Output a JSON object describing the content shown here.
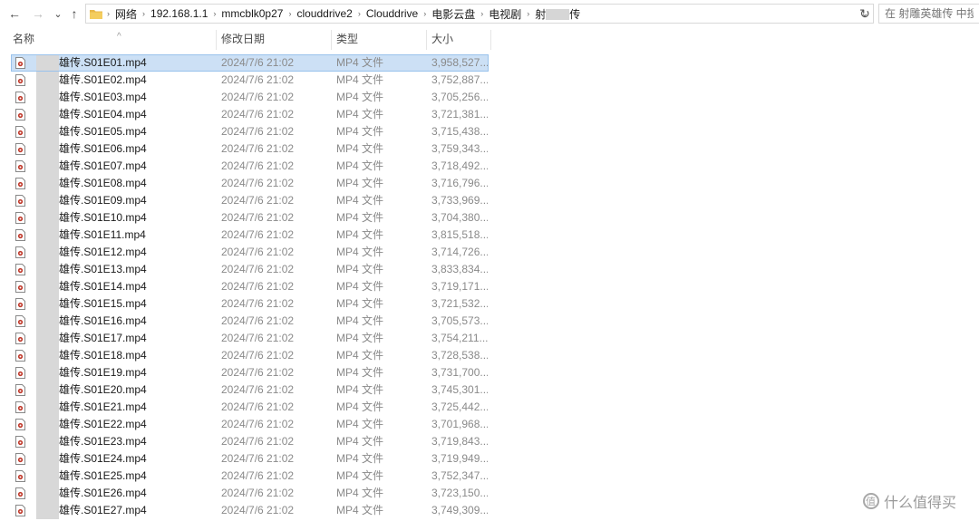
{
  "nav": {
    "back": "←",
    "forward": "→",
    "recent": "⌄",
    "up": "↑"
  },
  "address": {
    "crumbs": [
      "网络",
      "192.168.1.1",
      "mmcblk0p27",
      "clouddrive2",
      "Clouddrive",
      "电影云盘",
      "电视剧"
    ],
    "last_crumb_prefix": "射",
    "last_crumb_suffix": "传"
  },
  "search": {
    "placeholder": "在 射雕英雄传 中搜索"
  },
  "columns": {
    "name": "名称",
    "date": "修改日期",
    "type": "类型",
    "size": "大小"
  },
  "files": [
    {
      "name": "雄传.S01E01.mp4",
      "date": "2024/7/6 21:02",
      "type": "MP4 文件",
      "size": "3,958,527..."
    },
    {
      "name": "雄传.S01E02.mp4",
      "date": "2024/7/6 21:02",
      "type": "MP4 文件",
      "size": "3,752,887..."
    },
    {
      "name": "雄传.S01E03.mp4",
      "date": "2024/7/6 21:02",
      "type": "MP4 文件",
      "size": "3,705,256..."
    },
    {
      "name": "雄传.S01E04.mp4",
      "date": "2024/7/6 21:02",
      "type": "MP4 文件",
      "size": "3,721,381..."
    },
    {
      "name": "雄传.S01E05.mp4",
      "date": "2024/7/6 21:02",
      "type": "MP4 文件",
      "size": "3,715,438..."
    },
    {
      "name": "雄传.S01E06.mp4",
      "date": "2024/7/6 21:02",
      "type": "MP4 文件",
      "size": "3,759,343..."
    },
    {
      "name": "雄传.S01E07.mp4",
      "date": "2024/7/6 21:02",
      "type": "MP4 文件",
      "size": "3,718,492..."
    },
    {
      "name": "雄传.S01E08.mp4",
      "date": "2024/7/6 21:02",
      "type": "MP4 文件",
      "size": "3,716,796..."
    },
    {
      "name": "雄传.S01E09.mp4",
      "date": "2024/7/6 21:02",
      "type": "MP4 文件",
      "size": "3,733,969..."
    },
    {
      "name": "雄传.S01E10.mp4",
      "date": "2024/7/6 21:02",
      "type": "MP4 文件",
      "size": "3,704,380..."
    },
    {
      "name": "雄传.S01E11.mp4",
      "date": "2024/7/6 21:02",
      "type": "MP4 文件",
      "size": "3,815,518..."
    },
    {
      "name": "雄传.S01E12.mp4",
      "date": "2024/7/6 21:02",
      "type": "MP4 文件",
      "size": "3,714,726..."
    },
    {
      "name": "雄传.S01E13.mp4",
      "date": "2024/7/6 21:02",
      "type": "MP4 文件",
      "size": "3,833,834..."
    },
    {
      "name": "雄传.S01E14.mp4",
      "date": "2024/7/6 21:02",
      "type": "MP4 文件",
      "size": "3,719,171..."
    },
    {
      "name": "雄传.S01E15.mp4",
      "date": "2024/7/6 21:02",
      "type": "MP4 文件",
      "size": "3,721,532..."
    },
    {
      "name": "雄传.S01E16.mp4",
      "date": "2024/7/6 21:02",
      "type": "MP4 文件",
      "size": "3,705,573..."
    },
    {
      "name": "雄传.S01E17.mp4",
      "date": "2024/7/6 21:02",
      "type": "MP4 文件",
      "size": "3,754,211..."
    },
    {
      "name": "雄传.S01E18.mp4",
      "date": "2024/7/6 21:02",
      "type": "MP4 文件",
      "size": "3,728,538..."
    },
    {
      "name": "雄传.S01E19.mp4",
      "date": "2024/7/6 21:02",
      "type": "MP4 文件",
      "size": "3,731,700..."
    },
    {
      "name": "雄传.S01E20.mp4",
      "date": "2024/7/6 21:02",
      "type": "MP4 文件",
      "size": "3,745,301..."
    },
    {
      "name": "雄传.S01E21.mp4",
      "date": "2024/7/6 21:02",
      "type": "MP4 文件",
      "size": "3,725,442..."
    },
    {
      "name": "雄传.S01E22.mp4",
      "date": "2024/7/6 21:02",
      "type": "MP4 文件",
      "size": "3,701,968..."
    },
    {
      "name": "雄传.S01E23.mp4",
      "date": "2024/7/6 21:02",
      "type": "MP4 文件",
      "size": "3,719,843..."
    },
    {
      "name": "雄传.S01E24.mp4",
      "date": "2024/7/6 21:02",
      "type": "MP4 文件",
      "size": "3,719,949..."
    },
    {
      "name": "雄传.S01E25.mp4",
      "date": "2024/7/6 21:02",
      "type": "MP4 文件",
      "size": "3,752,347..."
    },
    {
      "name": "雄传.S01E26.mp4",
      "date": "2024/7/6 21:02",
      "type": "MP4 文件",
      "size": "3,723,150..."
    },
    {
      "name": "雄传.S01E27.mp4",
      "date": "2024/7/6 21:02",
      "type": "MP4 文件",
      "size": "3,749,309..."
    }
  ],
  "watermark": {
    "text": "什么值得买"
  },
  "colors": {
    "selection": "#cce0f5",
    "selection_border": "#99c2ec",
    "muted_text": "#8a8a8a",
    "folder": "#e8b84a"
  }
}
